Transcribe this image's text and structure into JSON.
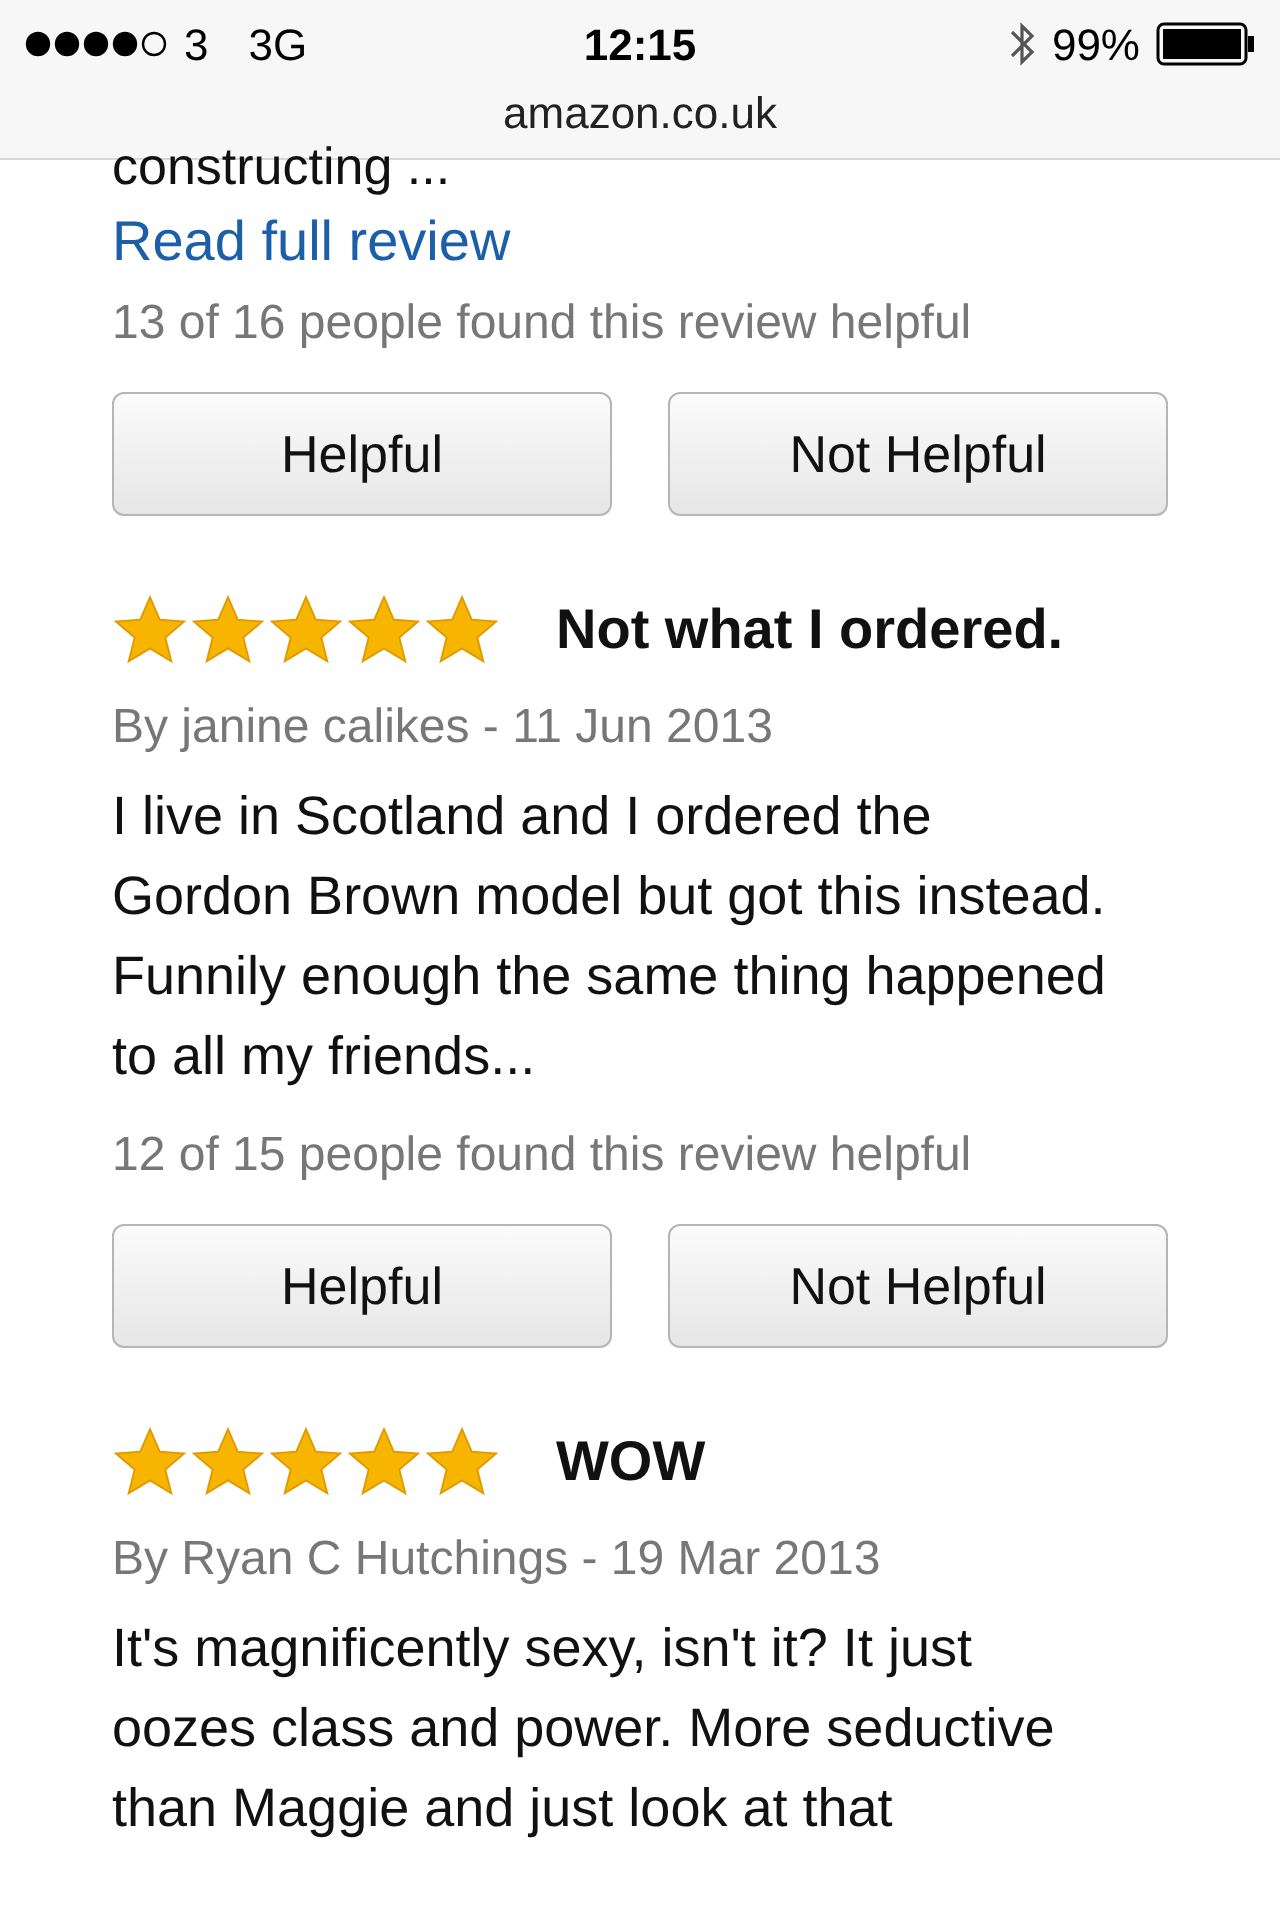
{
  "status_bar": {
    "carrier": "3",
    "network": "3G",
    "time": "12:15",
    "battery": "99%"
  },
  "address": "amazon.co.uk",
  "previous_review": {
    "body_end": "constructing ...",
    "read_more": "Read full review",
    "helpful_count": "13 of 16 people found this review helpful",
    "buttons": [
      "Helpful",
      "Not Helpful"
    ]
  },
  "reviews": [
    {
      "stars": 5,
      "title": "Not what I ordered.",
      "byline": "By janine calikes - 11 Jun 2013",
      "body": "I live in Scotland and I ordered the Gordon Brown model but got this instead. Funnily enough the same thing happened to all my friends...",
      "helpful_count": "12 of 15 people found this review helpful",
      "buttons": [
        "Helpful",
        "Not Helpful"
      ]
    },
    {
      "stars": 5,
      "title": "WOW",
      "byline": "By Ryan C Hutchings - 19 Mar 2013",
      "body": "It's magnificently sexy, isn't it? It just oozes class and power. More seductive than Maggie and just look at that"
    }
  ]
}
